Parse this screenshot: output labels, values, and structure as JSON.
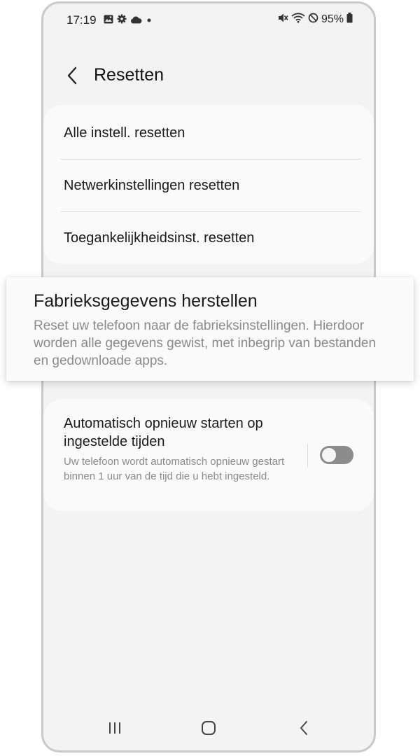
{
  "status_bar": {
    "time": "17:19",
    "battery": "95%",
    "left_icons": [
      "gallery-icon",
      "gear-icon",
      "cloud-icon",
      "dot-icon"
    ],
    "right_icons": [
      "mute-icon",
      "wifi-icon",
      "do-not-disturb-icon",
      "battery-icon"
    ]
  },
  "header": {
    "title": "Resetten",
    "back_icon": "chevron-left-icon"
  },
  "reset_list": {
    "items": [
      {
        "label": "Alle instell. resetten"
      },
      {
        "label": "Netwerkinstellingen resetten"
      },
      {
        "label": "Toegankelijkheidsinst. resetten"
      }
    ]
  },
  "factory_reset": {
    "title": "Fabrieksgegevens herstellen",
    "description": "Reset uw telefoon naar de fabrieksinstellingen. Hierdoor worden alle gegevens gewist, met inbegrip van bestanden en gedownloade apps."
  },
  "auto_restart": {
    "title": "Automatisch opnieuw starten op ingestelde tijden",
    "description": "Uw telefoon wordt automatisch opnieuw gestart binnen 1 uur van de tijd die u hebt ingesteld.",
    "enabled": false
  },
  "nav_bar": {
    "icons": [
      "recent-apps-icon",
      "home-icon",
      "back-icon"
    ]
  },
  "colors": {
    "background": "#f3f3f3",
    "card": "#fafafa",
    "text": "#1a1a1a",
    "secondary_text": "#8a8a8a",
    "toggle_off": "#8c8c8c"
  }
}
